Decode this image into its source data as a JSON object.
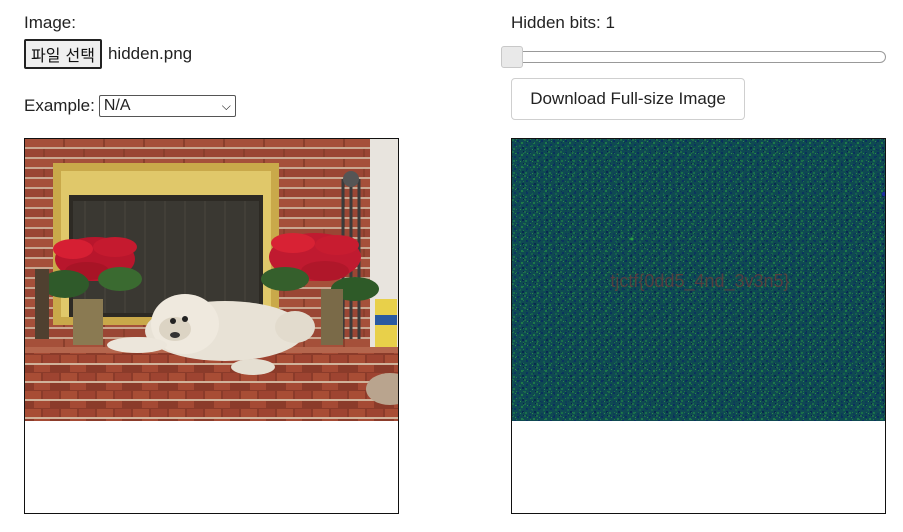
{
  "left": {
    "image_label": "Image:",
    "file_button_label": "파일 선택",
    "file_name": "hidden.png",
    "example_label": "Example:",
    "example_selected": "N/A"
  },
  "right": {
    "hidden_bits_label": "Hidden bits: 1",
    "hidden_bits_value": 1,
    "download_button_label": "Download Full-size Image",
    "hidden_text": "tjctf{0dd5_4nd_3v3n5}"
  },
  "colors": {
    "noise_base": "#0f4a52",
    "hidden_text_color": "#6b3b3b",
    "border": "#111111"
  }
}
